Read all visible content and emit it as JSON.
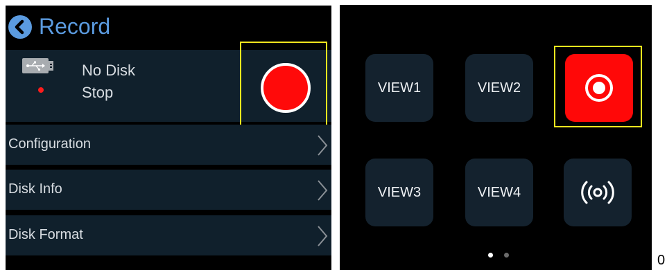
{
  "record_panel": {
    "title": "Record",
    "disk_status": "No Disk",
    "record_status": "Stop",
    "menu": [
      {
        "label": "Configuration"
      },
      {
        "label": "Disk Info"
      },
      {
        "label": "Disk Format"
      }
    ],
    "icons": {
      "back": "back-arrow-icon",
      "storage": "usb-drive-icon",
      "status": "red-dot-icon",
      "record": "record-button-icon",
      "menu_arrow": "chevron-right-icon"
    }
  },
  "home_panel": {
    "tiles": [
      {
        "label": "VIEW1"
      },
      {
        "label": "VIEW2"
      },
      {
        "label": "VIEW3"
      },
      {
        "label": "VIEW4"
      }
    ],
    "icons": {
      "record": "record-icon",
      "broadcast": "broadcast-icon"
    },
    "page": {
      "current": 1,
      "total": 2
    }
  },
  "footer_fragment": "0",
  "colors": {
    "accent_blue": "#5b9be0",
    "record_red": "#ff0a0a",
    "highlight_yellow": "#f2e61e",
    "card_background": "#10202c",
    "tile_background": "#14222e"
  }
}
